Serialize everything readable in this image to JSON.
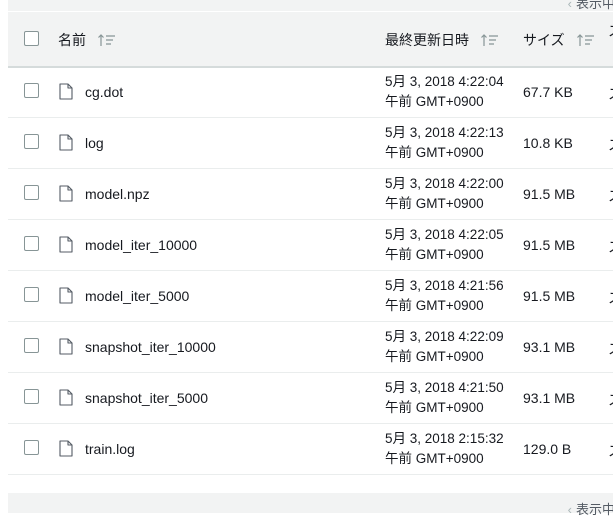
{
  "pager": {
    "label": "表示中"
  },
  "table": {
    "columns": {
      "name": "名前",
      "modified": "最終更新日時",
      "size": "サイズ",
      "extra": "ス"
    },
    "rows": [
      {
        "name": "cg.dot",
        "date_line1": "5月 3, 2018 4:22:04",
        "date_line2": "午前 GMT+0900",
        "size": "67.7 KB",
        "extra": "ス"
      },
      {
        "name": "log",
        "date_line1": "5月 3, 2018 4:22:13",
        "date_line2": "午前 GMT+0900",
        "size": "10.8 KB",
        "extra": "ス"
      },
      {
        "name": "model.npz",
        "date_line1": "5月 3, 2018 4:22:00",
        "date_line2": "午前 GMT+0900",
        "size": "91.5 MB",
        "extra": "ス"
      },
      {
        "name": "model_iter_10000",
        "date_line1": "5月 3, 2018 4:22:05",
        "date_line2": "午前 GMT+0900",
        "size": "91.5 MB",
        "extra": "ス"
      },
      {
        "name": "model_iter_5000",
        "date_line1": "5月 3, 2018 4:21:56",
        "date_line2": "午前 GMT+0900",
        "size": "91.5 MB",
        "extra": "ス"
      },
      {
        "name": "snapshot_iter_10000",
        "date_line1": "5月 3, 2018 4:22:09",
        "date_line2": "午前 GMT+0900",
        "size": "93.1 MB",
        "extra": "ス"
      },
      {
        "name": "snapshot_iter_5000",
        "date_line1": "5月 3, 2018 4:21:50",
        "date_line2": "午前 GMT+0900",
        "size": "93.1 MB",
        "extra": "ス"
      },
      {
        "name": "train.log",
        "date_line1": "5月 3, 2018 2:15:32",
        "date_line2": "午前 GMT+0900",
        "size": "129.0 B",
        "extra": "ス"
      }
    ]
  },
  "icons": {
    "sort": "sort-icon",
    "file": "file-icon",
    "pager_prev": "chevron-left-icon"
  },
  "colors": {
    "header_bg": "#f2f3f3",
    "border": "#d5dbdb",
    "row_divider": "#eaeded",
    "text": "#16191f"
  }
}
